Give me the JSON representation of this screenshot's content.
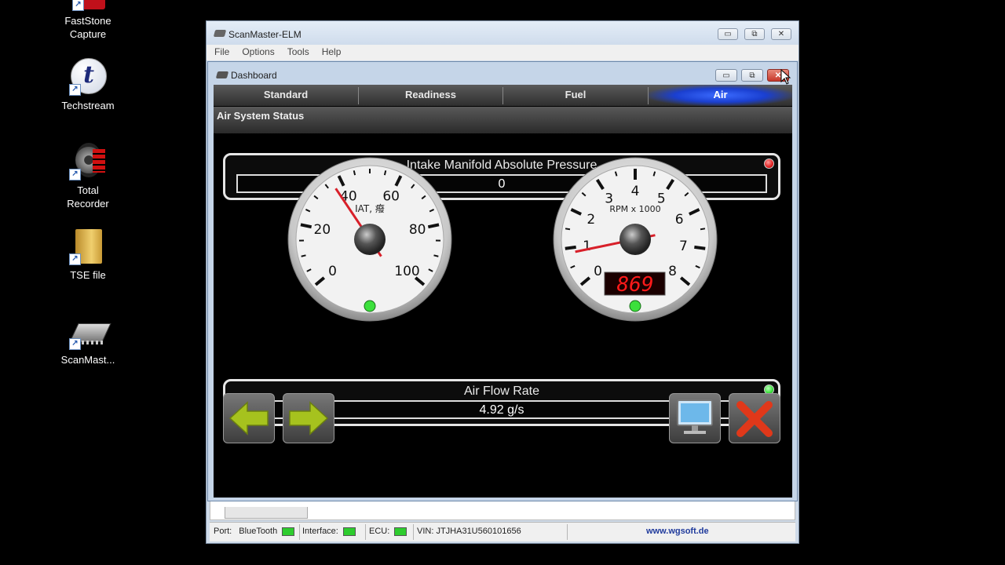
{
  "desktop": {
    "icons": [
      {
        "label": "FastStone\nCapture",
        "icon": "faststone-capture-icon"
      },
      {
        "label": "Techstream",
        "icon": "techstream-icon"
      },
      {
        "label": "Total\nRecorder",
        "icon": "total-recorder-icon"
      },
      {
        "label": "TSE file",
        "icon": "folder-icon"
      },
      {
        "label": "ScanMast...",
        "icon": "scanmaster-chip-icon"
      }
    ]
  },
  "main_window": {
    "title": "ScanMaster-ELM",
    "menu": [
      "File",
      "Options",
      "Tools",
      "Help"
    ]
  },
  "status_bar": {
    "port_label": "Port:",
    "port_value": "BlueTooth",
    "interface_label": "Interface:",
    "ecu_label": "ECU:",
    "vin": "VIN: JTJHA31U560101656",
    "website": "www.wgsoft.de",
    "led_color": "#2ecc2e"
  },
  "dashboard": {
    "title": "Dashboard",
    "tabs": [
      "Standard",
      "Readiness",
      "Fuel",
      "Air"
    ],
    "active_tab": "Air",
    "section_title": "Air System Status",
    "map_panel": {
      "title": "Intake Manifold Absolute Pressure",
      "value": "0",
      "led_color": "#e02020"
    },
    "iat_gauge": {
      "label": "IAT, 癈",
      "ticks": [
        "0",
        "20",
        "40",
        "60",
        "80",
        "100"
      ],
      "min": 0,
      "max": 100,
      "value": 37,
      "led_color": "#3ce03c"
    },
    "rpm_gauge": {
      "label": "RPM x 1000",
      "ticks": [
        "0",
        "1",
        "2",
        "3",
        "4",
        "5",
        "6",
        "7",
        "8"
      ],
      "min": 0,
      "max": 8,
      "value": 0.869,
      "digital": "869",
      "led_color": "#3ce03c"
    },
    "airflow_panel": {
      "title": "Air Flow Rate",
      "value": "4.92 g/s",
      "fill_fraction": 0.01,
      "led_color": "#3ce03c"
    },
    "accent_color": "#1a3fd0"
  }
}
